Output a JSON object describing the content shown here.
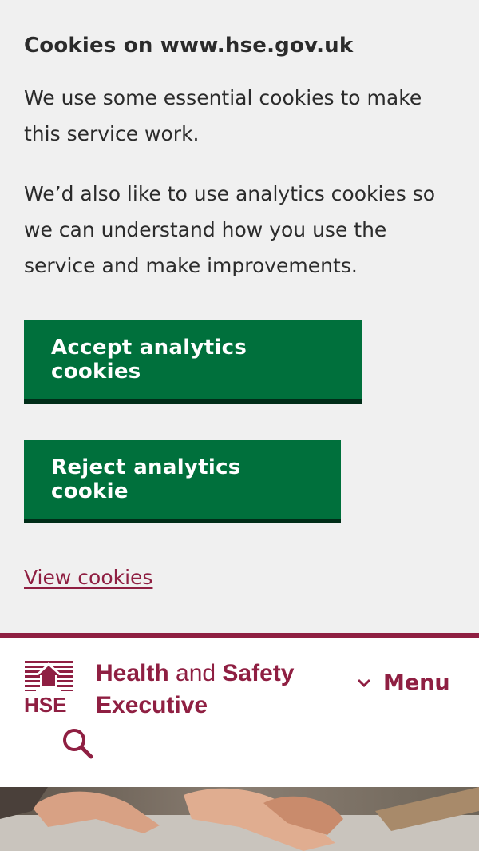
{
  "cookie_banner": {
    "title": "Cookies on www.hse.gov.uk",
    "paragraph_1": "We use some essential cookies to make this service work.",
    "paragraph_2": "We’d also like to use analytics cookies so we can understand how you use the service and make improvements.",
    "accept_label": "Accept analytics cookies",
    "reject_label": "Reject analytics cookie",
    "view_link": "View cookies"
  },
  "header": {
    "logo_letters": "HSE",
    "name_line_1_bold": "Health",
    "name_line_1_regular": " and ",
    "name_line_1_bold_2": "Safety",
    "name_line_2": "Executive",
    "menu_label": "Menu",
    "menu_icon": "chevron-down-icon",
    "search_icon": "search-icon"
  },
  "colors": {
    "banner_bg": "#f0f0f0",
    "button_green": "#00703c",
    "button_shadow": "#002d18",
    "brand": "#8f1f42"
  }
}
